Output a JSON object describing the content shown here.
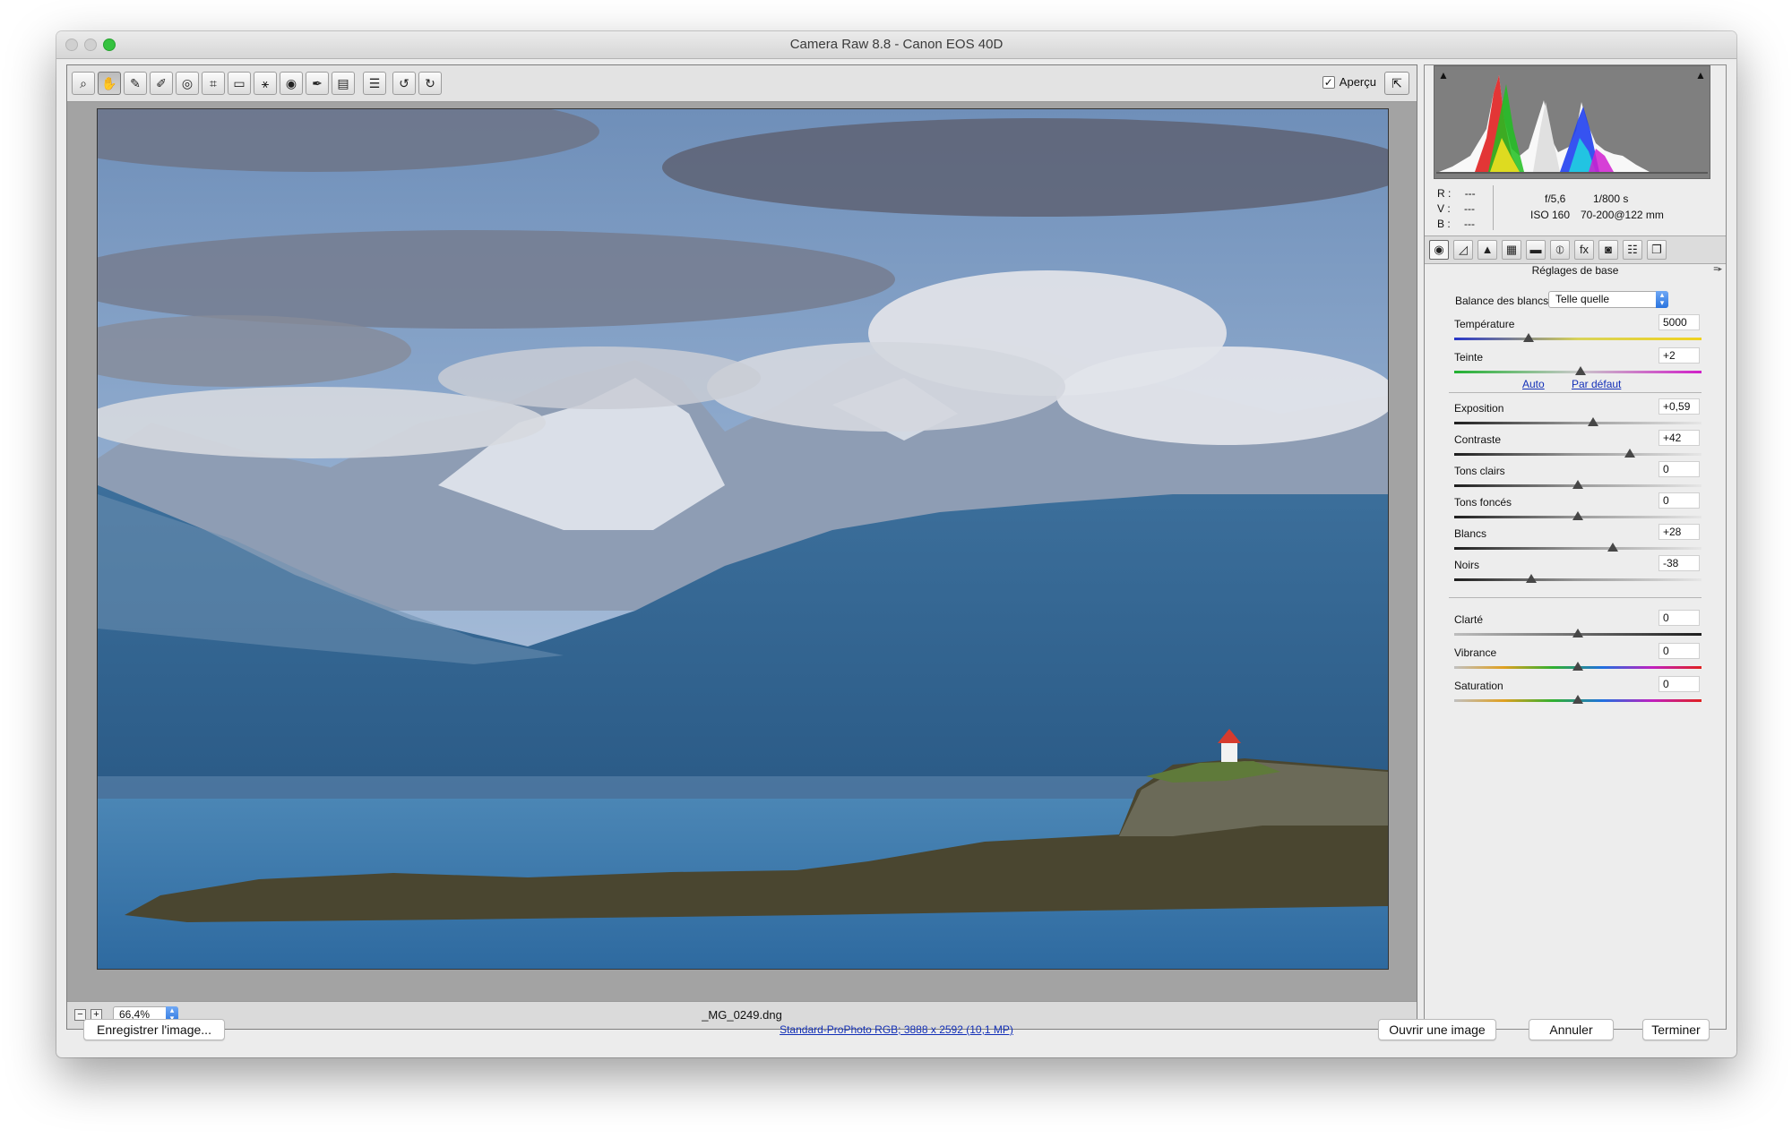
{
  "window": {
    "title": "Camera Raw 8.8  -  Canon EOS 40D"
  },
  "toolbar": {
    "tools": [
      {
        "name": "zoom-tool",
        "glyph": "⌕",
        "active": false
      },
      {
        "name": "hand-tool",
        "glyph": "✋",
        "active": true
      },
      {
        "name": "white-balance-tool",
        "glyph": "✎",
        "active": false
      },
      {
        "name": "color-sampler-tool",
        "glyph": "✐",
        "active": false
      },
      {
        "name": "targeted-adjustment-tool",
        "glyph": "◎",
        "active": false
      },
      {
        "name": "crop-tool",
        "glyph": "⌗",
        "active": false
      },
      {
        "name": "straighten-tool",
        "glyph": "▭",
        "active": false
      },
      {
        "name": "spot-removal-tool",
        "glyph": "⚹",
        "active": false
      },
      {
        "name": "red-eye-removal-tool",
        "glyph": "◉",
        "active": false
      },
      {
        "name": "adjustment-brush-tool",
        "glyph": "✒",
        "active": false
      },
      {
        "name": "graduated-filter-tool",
        "glyph": "▤",
        "active": false
      },
      {
        "name": "preferences-tool",
        "glyph": "☰",
        "active": false
      },
      {
        "name": "rotate-left-tool",
        "glyph": "↺",
        "active": false
      },
      {
        "name": "rotate-right-tool",
        "glyph": "↻",
        "active": false
      }
    ],
    "preview_label": "Aperçu",
    "preview_checked": true
  },
  "status": {
    "zoom": "66,4%",
    "filename": "_MG_0249.dng"
  },
  "histogram": {
    "r_label": "R :",
    "v_label": "V :",
    "b_label": "B :",
    "r_value": "---",
    "v_value": "---",
    "b_value": "---",
    "aperture": "f/5,6",
    "shutter": "1/800 s",
    "iso": "ISO 160",
    "lens": "70-200@122 mm"
  },
  "panel": {
    "tabs": [
      {
        "name": "tab-basic",
        "glyph": "◉"
      },
      {
        "name": "tab-tone-curve",
        "glyph": "◿"
      },
      {
        "name": "tab-detail",
        "glyph": "▲"
      },
      {
        "name": "tab-hsl",
        "glyph": "▦"
      },
      {
        "name": "tab-split-toning",
        "glyph": "▬"
      },
      {
        "name": "tab-lens-corrections",
        "glyph": "⦶"
      },
      {
        "name": "tab-effects",
        "glyph": "fx"
      },
      {
        "name": "tab-camera-calibration",
        "glyph": "◙"
      },
      {
        "name": "tab-presets",
        "glyph": "☷"
      },
      {
        "name": "tab-snapshots",
        "glyph": "❐"
      }
    ],
    "title": "Réglages de base",
    "wb_label": "Balance des blancs :",
    "wb_value": "Telle quelle",
    "temperature": {
      "label": "Température",
      "value": "5000",
      "pos": 0.3
    },
    "tint": {
      "label": "Teinte",
      "value": "+2",
      "pos": 0.51
    },
    "auto_label": "Auto",
    "default_label": "Par défaut",
    "sliders": [
      {
        "label": "Exposition",
        "value": "+0,59",
        "pos": 0.56
      },
      {
        "label": "Contraste",
        "value": "+42",
        "pos": 0.71
      },
      {
        "label": "Tons clairs",
        "value": "0",
        "pos": 0.5
      },
      {
        "label": "Tons foncés",
        "value": "0",
        "pos": 0.5
      },
      {
        "label": "Blancs",
        "value": "+28",
        "pos": 0.64
      },
      {
        "label": "Noirs",
        "value": "-38",
        "pos": 0.31
      }
    ],
    "presence": [
      {
        "label": "Clarté",
        "value": "0",
        "pos": 0.5
      },
      {
        "label": "Vibrance",
        "value": "0",
        "pos": 0.5
      },
      {
        "label": "Saturation",
        "value": "0",
        "pos": 0.5
      }
    ]
  },
  "bottom": {
    "save_label": "Enregistrer l'image...",
    "workflow_link": "Standard-ProPhoto RGB; 3888 x 2592 (10,1 MP)",
    "open_label": "Ouvrir une image",
    "cancel_label": "Annuler",
    "done_label": "Terminer"
  }
}
